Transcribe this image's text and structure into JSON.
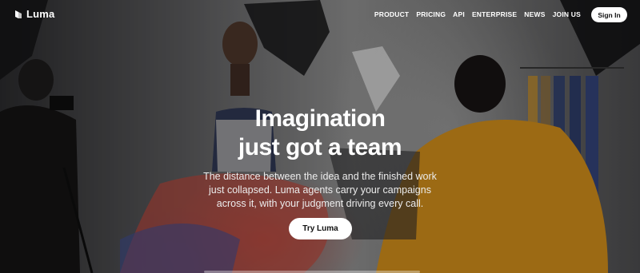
{
  "nav": {
    "logo_text": "Luma",
    "items": [
      "PRODUCT",
      "PRICING",
      "API",
      "ENTERPRISE",
      "NEWS",
      "JOIN US"
    ],
    "signin_label": "Sign In"
  },
  "hero": {
    "headline_line1": "Imagination",
    "headline_line2": "just got a team",
    "sub_line1": "The distance between the idea and the finished work",
    "sub_line2": "just collapsed. Luma agents carry your campaigns",
    "sub_line3": "across it, with your judgment driving every call.",
    "cta_label": "Try Luma"
  },
  "colors": {
    "button_bg": "#ffffff",
    "text": "#ffffff"
  }
}
